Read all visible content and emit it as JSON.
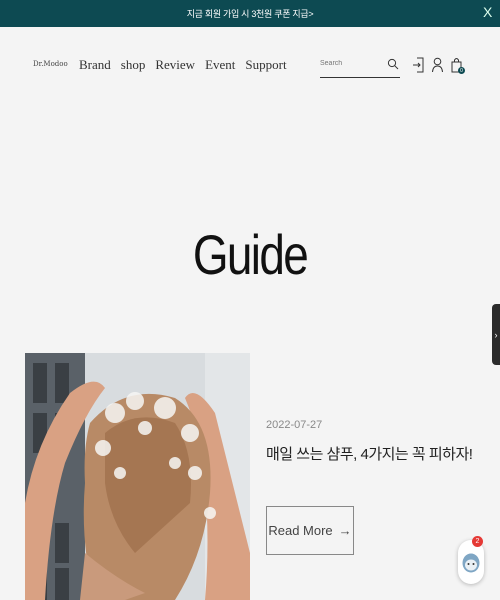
{
  "banner": {
    "text": "지금 회원 가입 시 3천원 쿠폰 지급>",
    "close": "X"
  },
  "header": {
    "logo": "Dr.Modoo",
    "nav": [
      "Brand",
      "shop",
      "Review",
      "Event",
      "Support"
    ],
    "search": {
      "placeholder": "Search",
      "icon": "search-icon"
    },
    "icons": [
      "login-icon",
      "user-icon",
      "cart-icon"
    ],
    "cart_count": "0"
  },
  "page": {
    "title": "Guide"
  },
  "side_tab": {
    "label": "›"
  },
  "post": {
    "date": "2022-07-27",
    "title": "매일 쓰는 샴푸, 4가지는 꼭 피하자!",
    "read_more": "Read More",
    "arrow": "→"
  },
  "chat": {
    "badge": "2",
    "icon": "chat-bot-icon"
  },
  "colors": {
    "brand": "#0d4a52",
    "background": "#f4f4f4",
    "badge": "#e53935"
  }
}
